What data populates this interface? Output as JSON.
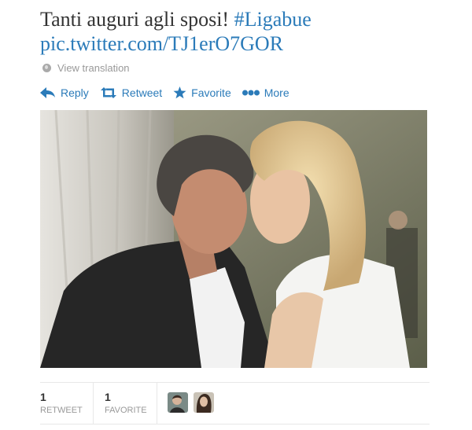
{
  "tweet": {
    "text": "Tanti auguri agli sposi! ",
    "hashtag": "#Ligabue",
    "pic_link": "pic.twitter.com/TJ1erO7GOR"
  },
  "translate": {
    "label": "View translation",
    "icon": "globe-icon"
  },
  "actions": [
    {
      "label": "Reply",
      "icon": "reply-icon"
    },
    {
      "label": "Retweet",
      "icon": "retweet-icon"
    },
    {
      "label": "Favorite",
      "icon": "star-icon"
    },
    {
      "label": "More",
      "icon": "more-dots-icon"
    }
  ],
  "stats": {
    "retweets": {
      "count": "1",
      "label": "RETWEET"
    },
    "favorites": {
      "count": "1",
      "label": "FAVORITE"
    }
  },
  "colors": {
    "link": "#2b7bb9",
    "text": "#333333",
    "muted": "#999999"
  }
}
